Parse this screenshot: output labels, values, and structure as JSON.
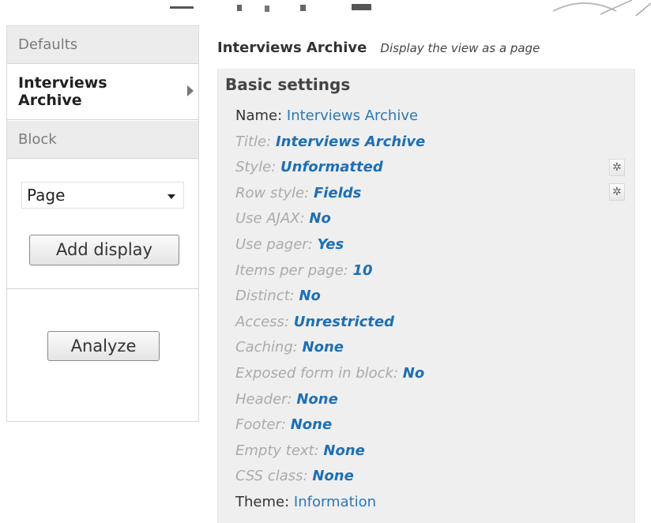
{
  "tabs": {
    "defaults": "Defaults",
    "active": "Interviews Archive",
    "block": "Block"
  },
  "display_select": {
    "value": "Page"
  },
  "buttons": {
    "add_display": "Add display",
    "analyze": "Analyze"
  },
  "header": {
    "title": "Interviews Archive",
    "description": "Display the view as a page"
  },
  "basic_settings": {
    "title": "Basic settings",
    "rows": [
      {
        "label": "Name:",
        "value": "Interviews Archive"
      },
      {
        "label": "Title:",
        "value": "Interviews Archive"
      },
      {
        "label": "Style:",
        "value": "Unformatted"
      },
      {
        "label": "Row style:",
        "value": "Fields"
      },
      {
        "label": "Use AJAX:",
        "value": "No"
      },
      {
        "label": "Use pager:",
        "value": "Yes"
      },
      {
        "label": "Items per page:",
        "value": "10"
      },
      {
        "label": "Distinct:",
        "value": "No"
      },
      {
        "label": "Access:",
        "value": "Unrestricted"
      },
      {
        "label": "Caching:",
        "value": "None"
      },
      {
        "label": "Exposed form in block:",
        "value": "No"
      },
      {
        "label": "Header:",
        "value": "None"
      },
      {
        "label": "Footer:",
        "value": "None"
      },
      {
        "label": "Empty text:",
        "value": "None"
      },
      {
        "label": "CSS class:",
        "value": "None"
      },
      {
        "label": "Theme:",
        "value": "Information"
      }
    ]
  },
  "icons": {
    "row_settings": "gear-icon",
    "tab_pointer": "arrow-right-icon",
    "dropdown": "chevron-down-icon"
  },
  "colors": {
    "link": "#2a77b8",
    "muted_label": "#aaaaaa",
    "panel_bg": "#efefef",
    "tab_bg": "#ececec"
  }
}
